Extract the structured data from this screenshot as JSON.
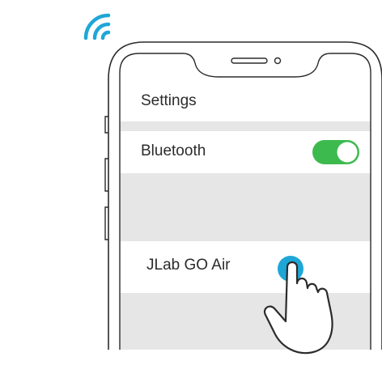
{
  "settings": {
    "title": "Settings"
  },
  "bluetooth": {
    "label": "Bluetooth",
    "enabled": true
  },
  "device": {
    "name": "JLab GO Air"
  },
  "colors": {
    "toggle_on": "#3dba4e",
    "tap_indicator": "#1ea7d6",
    "wifi_signal": "#1ea7d6",
    "gray_band": "#e6e6e6",
    "outline": "#2b2b2b"
  },
  "icons": [
    "wifi-signal-icon",
    "toggle-switch-icon",
    "pointing-hand-icon"
  ]
}
